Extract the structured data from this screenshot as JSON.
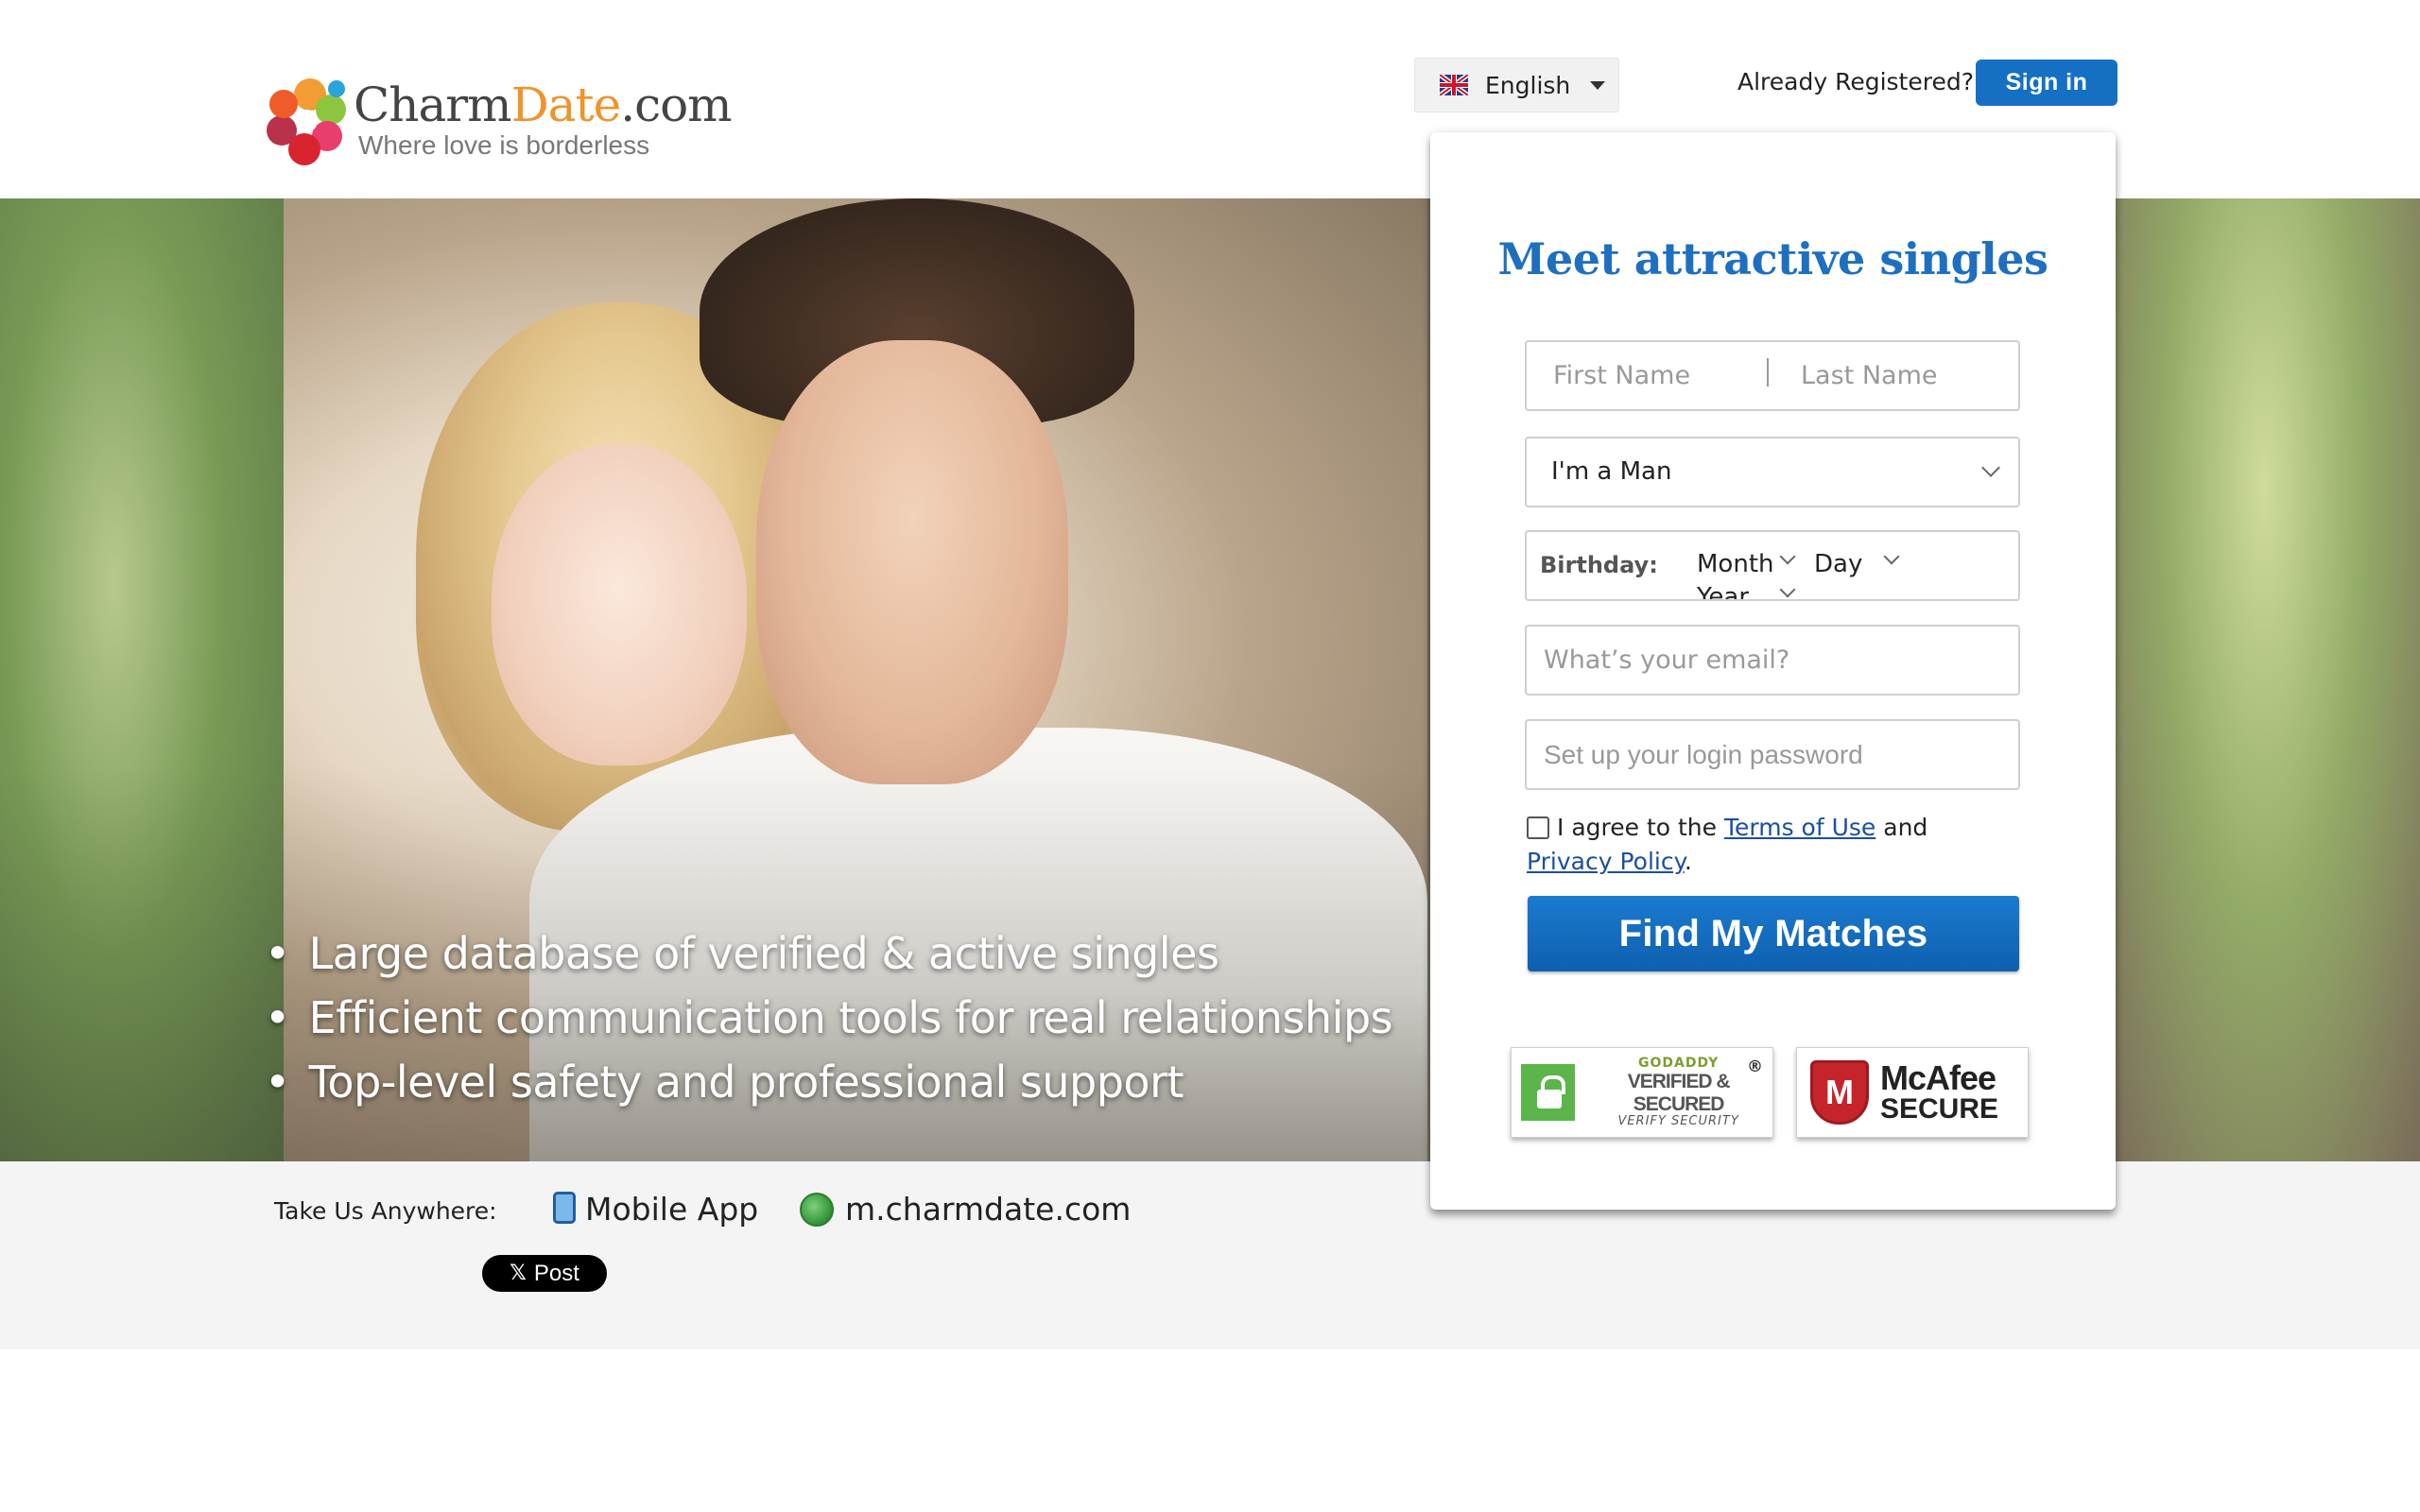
{
  "header": {
    "logo_name_1": "Charm",
    "logo_name_2": "Date",
    "logo_name_3": ".com",
    "logo_tagline": "Where love is borderless",
    "language": "English",
    "already_registered": "Already Registered?",
    "sign_in": "Sign in"
  },
  "hero": {
    "bullets": [
      "Large database of verified & active singles",
      "Efficient communication tools for real relationships",
      "Top-level safety and professional support"
    ]
  },
  "form": {
    "title": "Meet attractive singles",
    "first_name_placeholder": "First Name",
    "last_name_placeholder": "Last Name",
    "gender_value": "I'm a Man",
    "birthday_label": "Birthday:",
    "month_label": "Month",
    "day_label": "Day",
    "year_label": "Year",
    "email_placeholder": "What’s your email?",
    "password_placeholder": "Set up your login password",
    "terms_prefix": "I agree to the ",
    "terms_of_use": "Terms of Use",
    "terms_and": " and ",
    "privacy_policy": "Privacy Policy",
    "terms_suffix": ".",
    "submit": "Find My Matches"
  },
  "badges": {
    "godaddy_small": "GODADDY",
    "godaddy_big": "VERIFIED & SECURED",
    "godaddy_sub": "VERIFY SECURITY",
    "godaddy_reg": "®",
    "mcafee_big": "McAfee",
    "mcafee_small": "SECURE",
    "mcafee_letter": "M"
  },
  "footer": {
    "take_us": "Take Us Anywhere:",
    "mobile_app": "Mobile App",
    "mobile_site": "m.charmdate.com",
    "post_label": "Post",
    "post_icon": "𝕏"
  },
  "colors": {
    "brand_blue": "#1570c4",
    "title_blue": "#1e6fc0",
    "logo_orange": "#f0932b"
  }
}
